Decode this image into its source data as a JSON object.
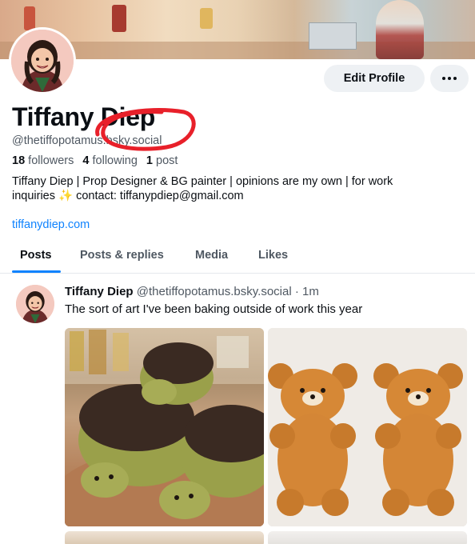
{
  "profile": {
    "display_name": "Tiffany Diep",
    "handle": "@thetiffopotamus.bsky.social",
    "followers_count": "18",
    "followers_label": "followers",
    "following_count": "4",
    "following_label": "following",
    "posts_count": "1",
    "posts_label": "post",
    "bio_line1": "Tiffany Diep | Prop Designer & BG painter | opinions are my own | for work",
    "bio_line2": "inquiries ✨ contact: tiffanypdiep@gmail.com",
    "website": "tiffanydiep.com"
  },
  "actions": {
    "edit_label": "Edit Profile"
  },
  "tabs": [
    {
      "label": "Posts"
    },
    {
      "label": "Posts & replies"
    },
    {
      "label": "Media"
    },
    {
      "label": "Likes"
    }
  ],
  "post": {
    "author": "Tiffany Diep",
    "handle": "@thetiffopotamus.bsky.social",
    "time": "· 1m",
    "text": "The sort of art I've been baking outside of work this year"
  },
  "colors": {
    "accent": "#1083fe",
    "annotation": "#e8202a"
  }
}
